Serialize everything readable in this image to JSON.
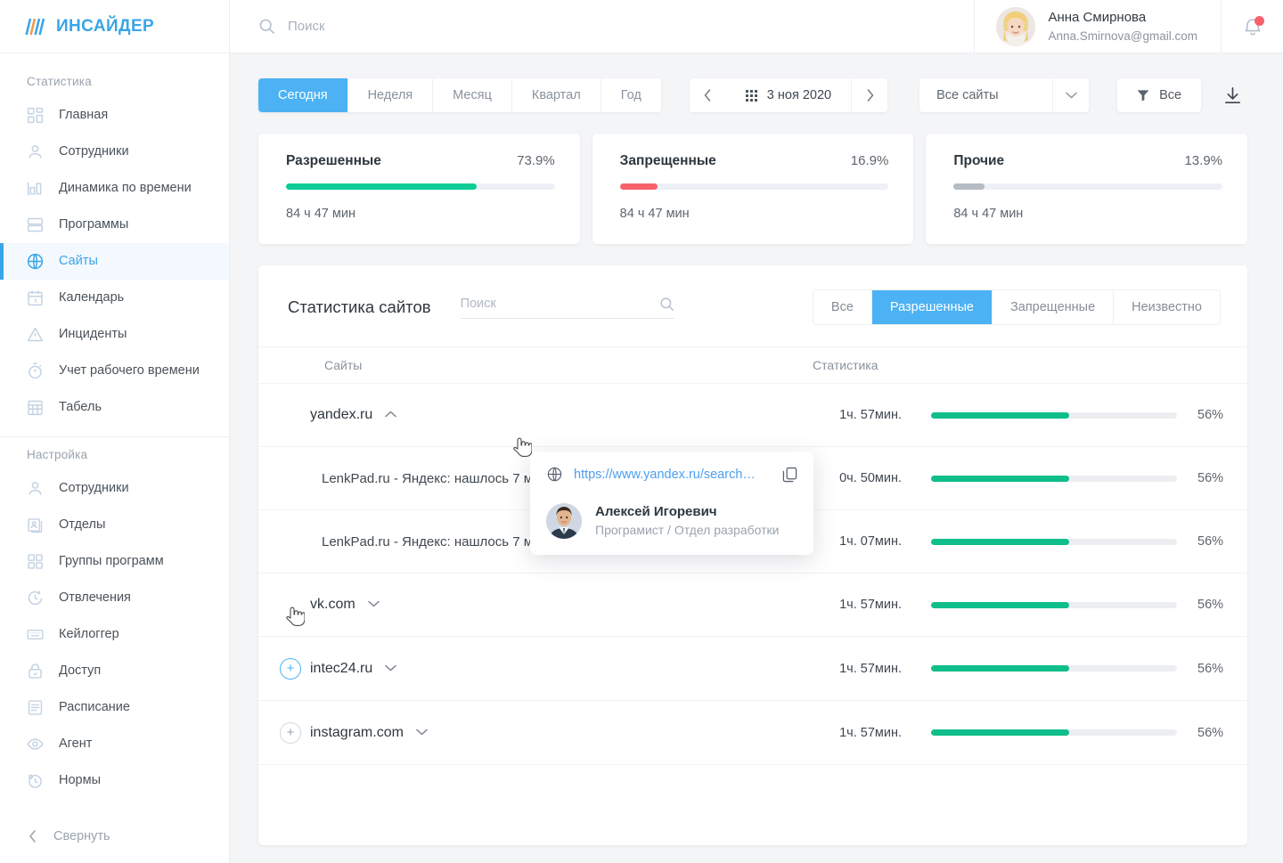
{
  "brand": {
    "name": "ИНСАЙДЕР",
    "accent": "#3aa5e8"
  },
  "topbar": {
    "search_placeholder": "Поиск",
    "user_name": "Анна Смирнова",
    "user_email": "Anna.Smirnova@gmail.com",
    "notification_icon": "bell-icon",
    "has_notification": true
  },
  "sidebar": {
    "groups": [
      {
        "title": "Статистика",
        "items": [
          {
            "label": "Главная",
            "icon": "dashboard-icon",
            "active": false
          },
          {
            "label": "Сотрудники",
            "icon": "user-icon",
            "active": false
          },
          {
            "label": "Динамика по времени",
            "icon": "bar-chart-icon",
            "active": false
          },
          {
            "label": "Программы",
            "icon": "window-icon",
            "active": false
          },
          {
            "label": "Сайты",
            "icon": "globe-icon",
            "active": true
          },
          {
            "label": "Календарь",
            "icon": "calendar-icon",
            "active": false
          },
          {
            "label": "Инциденты",
            "icon": "warning-triangle-icon",
            "active": false
          },
          {
            "label": "Учет рабочего времени",
            "icon": "stopwatch-icon",
            "active": false
          },
          {
            "label": "Табель",
            "icon": "table-grid-icon",
            "active": false
          }
        ]
      },
      {
        "title": "Настройка",
        "items": [
          {
            "label": "Сотрудники",
            "icon": "user-icon",
            "active": false
          },
          {
            "label": "Отделы",
            "icon": "id-card-icon",
            "active": false
          },
          {
            "label": "Группы программ",
            "icon": "squares-icon",
            "active": false
          },
          {
            "label": "Отвлечения",
            "icon": "clock-arrow-icon",
            "active": false
          },
          {
            "label": "Кейлоггер",
            "icon": "keyboard-icon",
            "active": false
          },
          {
            "label": "Доступ",
            "icon": "lock-icon",
            "active": false
          },
          {
            "label": "Расписание",
            "icon": "list-icon",
            "active": false
          },
          {
            "label": "Агент",
            "icon": "eye-icon",
            "active": false
          },
          {
            "label": "Нормы",
            "icon": "clock-badge-icon",
            "active": false
          }
        ]
      }
    ],
    "collapse_label": "Свернуть",
    "collapse_icon": "chevron-left-icon"
  },
  "toolbar": {
    "periods": [
      {
        "label": "Сегодня",
        "active": true
      },
      {
        "label": "Неделя",
        "active": false
      },
      {
        "label": "Месяц",
        "active": false
      },
      {
        "label": "Квартал",
        "active": false
      },
      {
        "label": "Год",
        "active": false
      }
    ],
    "prev_icon": "chevron-left-icon",
    "next_icon": "chevron-right-icon",
    "date_icon": "calendar-dots-icon",
    "date_value": "3 ноя 2020",
    "site_select_value": "Все сайты",
    "site_select_caret": "chevron-down-icon",
    "filter_icon": "funnel-icon",
    "filter_label": "Все",
    "download_icon": "download-icon"
  },
  "cards": [
    {
      "title": "Разрешенные",
      "percent": "73.9%",
      "value": 73.9,
      "duration": "84 ч 47 мин",
      "color": "#0fcc97"
    },
    {
      "title": "Запрещенные",
      "percent": "16.9%",
      "value": 16.9,
      "duration": "84 ч 47 мин",
      "color": "#f8616b"
    },
    {
      "title": "Прочие",
      "percent": "13.9%",
      "value": 13.9,
      "duration": "84 ч 47 мин",
      "color": "#b6bcc4"
    }
  ],
  "panel": {
    "title": "Статистика сайтов",
    "search_placeholder": "Поиск",
    "search_icon": "search-icon",
    "tabs": [
      {
        "label": "Все",
        "active": false
      },
      {
        "label": "Разрешенные",
        "active": true
      },
      {
        "label": "Запрещенные",
        "active": false
      },
      {
        "label": "Неизвестно",
        "active": false
      }
    ],
    "columns": {
      "site": "Сайты",
      "stat": "Статистика"
    },
    "rows": [
      {
        "type": "site",
        "name": "yandex.ru",
        "chevron": "chevron-up-icon",
        "expanded": true,
        "plus": false,
        "duration": "1ч. 57мин.",
        "bar": 56,
        "percent": "56%"
      },
      {
        "type": "child",
        "name": "LenkPad.ru - Яндекс: нашлось 7 млн. изображений",
        "duration": "0ч. 50мин.",
        "bar": 56,
        "percent": "56%"
      },
      {
        "type": "child",
        "name": "LenkPad.ru - Яндекс: нашлось 7 млн. изображений",
        "duration": "1ч. 07мин.",
        "bar": 56,
        "percent": "56%"
      },
      {
        "type": "site",
        "name": "vk.com",
        "chevron": "chevron-down-icon",
        "expanded": false,
        "plus": false,
        "duration": "1ч. 57мин.",
        "bar": 56,
        "percent": "56%"
      },
      {
        "type": "site",
        "name": "intec24.ru",
        "chevron": "chevron-down-icon",
        "expanded": false,
        "plus": true,
        "plus_highlight": true,
        "duration": "1ч. 57мин.",
        "bar": 56,
        "percent": "56%"
      },
      {
        "type": "site",
        "name": "instagram.com",
        "chevron": "chevron-down-icon",
        "expanded": false,
        "plus": true,
        "plus_highlight": false,
        "duration": "1ч. 57мин.",
        "bar": 56,
        "percent": "56%"
      }
    ],
    "bar_color": "#0fbe8a"
  },
  "popover": {
    "globe_icon": "globe-icon",
    "url": "https://www.yandex.ru/search…",
    "copy_icon": "copy-icon",
    "person_name": "Алексей Игоревич",
    "person_role": "Програмист / Отдел разработки"
  }
}
